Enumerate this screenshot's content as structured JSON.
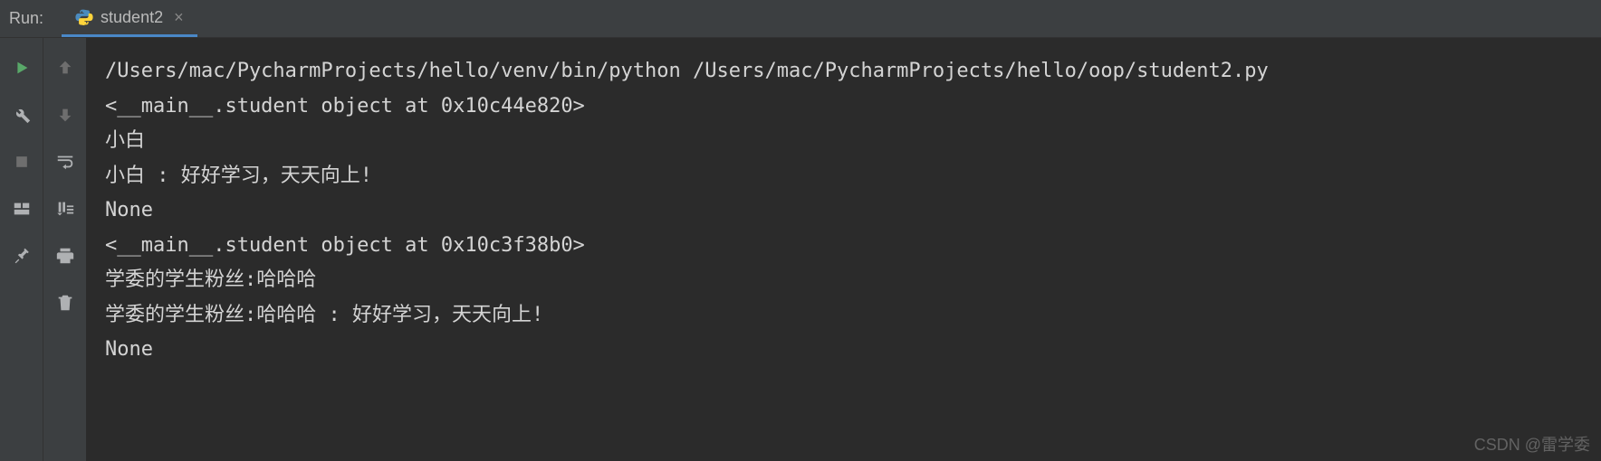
{
  "header": {
    "run_label": "Run:",
    "tab": {
      "label": "student2",
      "close_glyph": "×"
    }
  },
  "console": {
    "lines": [
      "/Users/mac/PycharmProjects/hello/venv/bin/python /Users/mac/PycharmProjects/hello/oop/student2.py",
      "<__main__.student object at 0x10c44e820>",
      "小白",
      "小白 : 好好学习，天天向上!",
      "None",
      "<__main__.student object at 0x10c3f38b0>",
      "学委的学生粉丝:哈哈哈",
      "学委的学生粉丝:哈哈哈 : 好好学习，天天向上!",
      "None"
    ]
  },
  "watermark": "CSDN @雷学委"
}
